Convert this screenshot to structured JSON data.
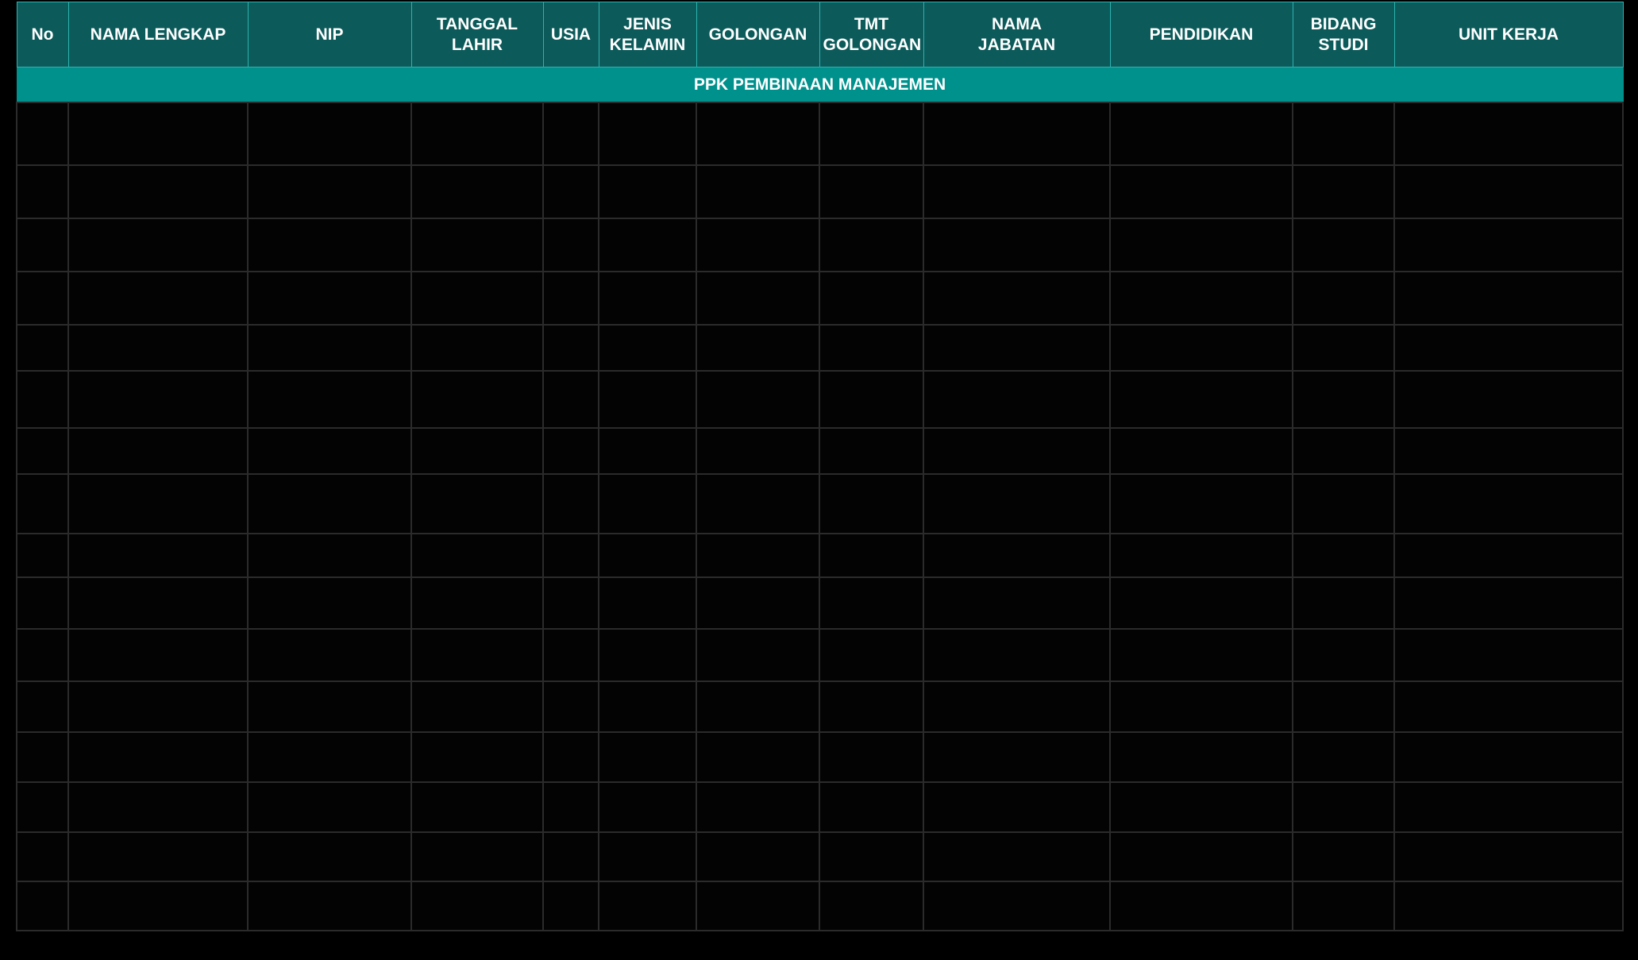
{
  "table": {
    "columns": [
      "No",
      "NAMA LENGKAP",
      "NIP",
      "TANGGAL\nLAHIR",
      "USIA",
      "JENIS\nKELAMIN",
      "GOLONGAN",
      "TMT\nGOLONGAN",
      "NAMA\nJABATAN",
      "PENDIDIKAN",
      "BIDANG\nSTUDI",
      "UNIT KERJA"
    ],
    "section_title": "PPK PEMBINAAN MANAJEMEN",
    "rows": [
      [
        "",
        "",
        "",
        "",
        "",
        "",
        "",
        "",
        "",
        "",
        "",
        ""
      ],
      [
        "",
        "",
        "",
        "",
        "",
        "",
        "",
        "",
        "",
        "",
        "",
        ""
      ],
      [
        "",
        "",
        "",
        "",
        "",
        "",
        "",
        "",
        "",
        "",
        "",
        ""
      ],
      [
        "",
        "",
        "",
        "",
        "",
        "",
        "",
        "",
        "",
        "",
        "",
        ""
      ],
      [
        "",
        "",
        "",
        "",
        "",
        "",
        "",
        "",
        "",
        "",
        "",
        ""
      ],
      [
        "",
        "",
        "",
        "",
        "",
        "",
        "",
        "",
        "",
        "",
        "",
        ""
      ],
      [
        "",
        "",
        "",
        "",
        "",
        "",
        "",
        "",
        "",
        "",
        "",
        ""
      ],
      [
        "",
        "",
        "",
        "",
        "",
        "",
        "",
        "",
        "",
        "",
        "",
        ""
      ],
      [
        "",
        "",
        "",
        "",
        "",
        "",
        "",
        "",
        "",
        "",
        "",
        ""
      ],
      [
        "",
        "",
        "",
        "",
        "",
        "",
        "",
        "",
        "",
        "",
        "",
        ""
      ],
      [
        "",
        "",
        "",
        "",
        "",
        "",
        "",
        "",
        "",
        "",
        "",
        ""
      ],
      [
        "",
        "",
        "",
        "",
        "",
        "",
        "",
        "",
        "",
        "",
        "",
        ""
      ],
      [
        "",
        "",
        "",
        "",
        "",
        "",
        "",
        "",
        "",
        "",
        "",
        ""
      ],
      [
        "",
        "",
        "",
        "",
        "",
        "",
        "",
        "",
        "",
        "",
        "",
        ""
      ],
      [
        "",
        "",
        "",
        "",
        "",
        "",
        "",
        "",
        "",
        "",
        "",
        ""
      ],
      [
        "",
        "",
        "",
        "",
        "",
        "",
        "",
        "",
        "",
        "",
        "",
        ""
      ]
    ]
  },
  "colors": {
    "header_bg": "#0c5a5a",
    "header_border": "#2bb4b0",
    "section_bg": "#00918d",
    "grid_line": "#2b2b2b",
    "page_bg": "#000000"
  }
}
